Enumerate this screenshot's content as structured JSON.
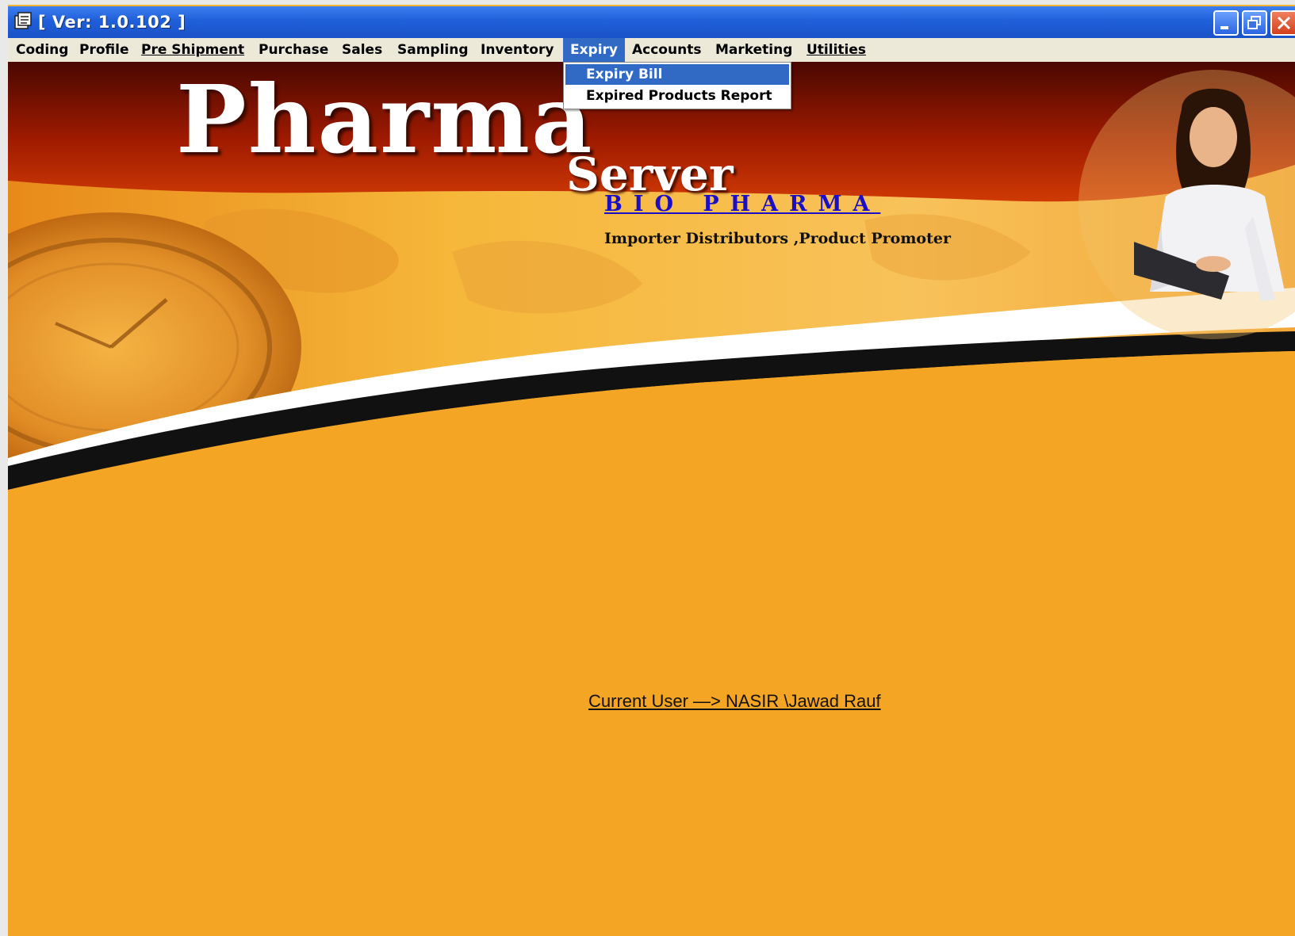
{
  "window": {
    "title": "[ Ver: 1.0.102 ]",
    "icon": "app-document-icon",
    "controls": [
      "minimize-icon",
      "restore-icon",
      "close-icon"
    ]
  },
  "menubar": {
    "items": [
      {
        "label": "Coding"
      },
      {
        "label": "Profile"
      },
      {
        "label": "Pre Shipment"
      },
      {
        "label": "Purchase"
      },
      {
        "label": "Sales"
      },
      {
        "label": "Sampling"
      },
      {
        "label": "Inventory"
      },
      {
        "label": "Expiry"
      },
      {
        "label": "Accounts"
      },
      {
        "label": "Marketing"
      },
      {
        "label": "Utilities"
      }
    ],
    "active": "Expiry"
  },
  "expiry_menu": {
    "items": [
      {
        "label": "Expiry Bill"
      },
      {
        "label": "Expired Products Report"
      }
    ],
    "highlighted": "Expiry Bill"
  },
  "banner": {
    "logo_main": "Pharma",
    "logo_sub": "Server",
    "company": "BIO PHARMA",
    "tagline": "Importer Distributors ,Product Promoter"
  },
  "status": {
    "current_user": "Current User —> NASIR \\Jawad Rauf"
  },
  "colors": {
    "titlebar": "#1f5fd9",
    "menu_highlight": "#316ac5",
    "background": "#f5a524",
    "banner_red": "#a51a00",
    "company_text": "#1a0ec8"
  }
}
